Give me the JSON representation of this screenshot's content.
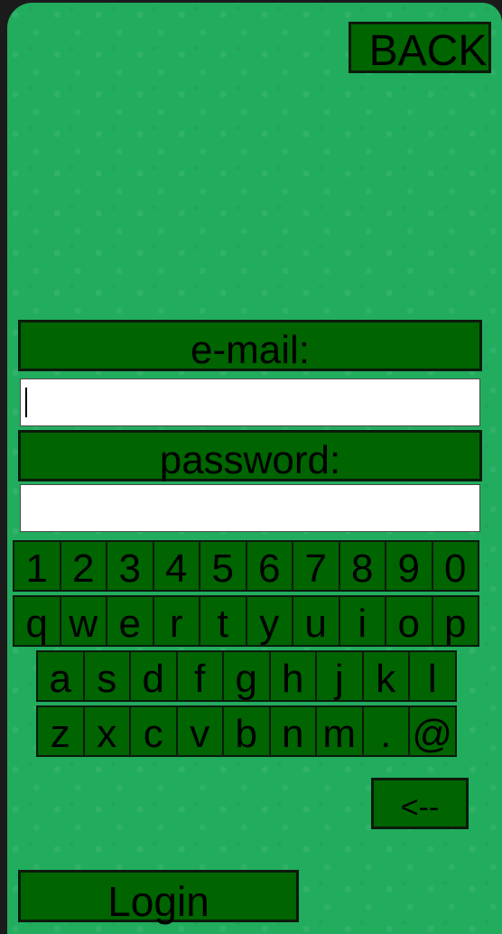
{
  "header": {
    "back_label": "BACK"
  },
  "form": {
    "email_label": "e-mail:",
    "email_value": "",
    "password_label": "password:",
    "password_value": ""
  },
  "keyboard": {
    "rows": [
      [
        "1",
        "2",
        "3",
        "4",
        "5",
        "6",
        "7",
        "8",
        "9",
        "0"
      ],
      [
        "q",
        "w",
        "e",
        "r",
        "t",
        "y",
        "u",
        "i",
        "o",
        "p"
      ],
      [
        "a",
        "s",
        "d",
        "f",
        "g",
        "h",
        "j",
        "k",
        "l"
      ],
      [
        "z",
        "x",
        "c",
        "v",
        "b",
        "n",
        "m",
        ".",
        "@"
      ]
    ],
    "backspace_label": "<--"
  },
  "actions": {
    "login_label": "Login"
  },
  "colors": {
    "background": "#22ac5e",
    "button": "#006400",
    "border": "#0c1a0c",
    "field": "#ffffff"
  }
}
